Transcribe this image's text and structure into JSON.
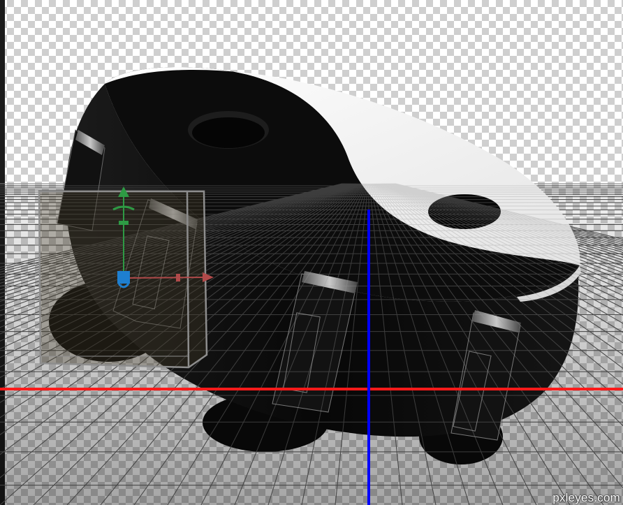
{
  "canvas": {
    "background": "transparency-checkerboard",
    "checker_colors": [
      "#ffffff",
      "#cfcfcf"
    ]
  },
  "object": {
    "name": "yin-yang-3d-body",
    "colors": {
      "dark": "#0d0d0d",
      "light": "#ffffff"
    }
  },
  "gizmo": {
    "y_axis_color": "#2e9a44",
    "x_axis_color": "#b04a4a",
    "z_axis_color": "#1e7fd0"
  },
  "guides": {
    "horizontal_color": "#ff1a1a",
    "vertical_color": "#0000ff"
  },
  "watermark": {
    "text": "pxleyes.com"
  }
}
